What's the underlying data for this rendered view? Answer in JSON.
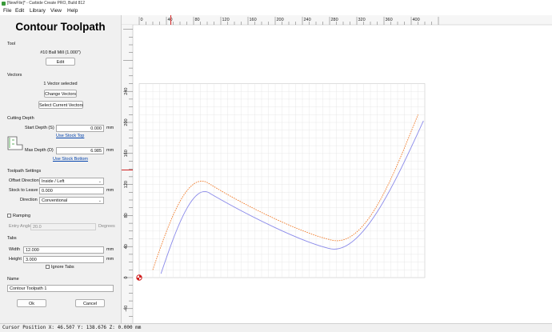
{
  "window": {
    "title": "[NewFile]* - Carbide Create PRO, Build 812"
  },
  "menubar": {
    "items": [
      {
        "label": "File"
      },
      {
        "label": "Edit"
      },
      {
        "label": "Library"
      },
      {
        "label": "View"
      },
      {
        "label": "Help"
      }
    ]
  },
  "panel": {
    "title": "Contour Toolpath",
    "tool": {
      "section_label": "Tool",
      "tool_name": "#10 Ball Mill (1.000\")",
      "edit_label": "Edit"
    },
    "vectors": {
      "section_label": "Vectors",
      "status": "1 Vector selected",
      "change_label": "Change Vectors",
      "select_current_label": "Select Current Vectors"
    },
    "cutting_depth": {
      "section_label": "Cutting Depth",
      "start_depth_label": "Start Depth (S)",
      "start_depth_value": "0.000",
      "start_depth_unit": "mm",
      "use_stock_top_label": "Use Stock Top",
      "max_depth_label": "Max Depth (D)",
      "max_depth_value": "6.985",
      "max_depth_unit": "mm",
      "use_stock_bottom_label": "Use Stock Bottom"
    },
    "toolpath_settings": {
      "section_label": "Toolpath Settings",
      "offset_direction_label": "Offset Direction",
      "offset_direction_value": "Inside / Left",
      "stock_to_leave_label": "Stock to Leave",
      "stock_to_leave_value": "0.000",
      "stock_to_leave_unit": "mm",
      "direction_label": "Direction",
      "direction_value": "Conventional"
    },
    "ramping": {
      "checkbox_label": "Ramping",
      "entry_angle_label": "Entry Angle",
      "entry_angle_value": "20.0",
      "entry_angle_unit": "Degrees"
    },
    "tabs": {
      "section_label": "Tabs",
      "width_label": "Width",
      "width_value": "12.000",
      "width_unit": "mm",
      "height_label": "Height",
      "height_value": "3.000",
      "height_unit": "mm",
      "ignore_label": "Ignore Tabs"
    },
    "name": {
      "section_label": "Name",
      "value": "Contour Toolpath 1"
    },
    "ok_label": "Ok",
    "cancel_label": "Cancel"
  },
  "view": {
    "x_ticks": [
      "0",
      "40",
      "80",
      "120",
      "160",
      "200",
      "240",
      "280",
      "320",
      "360",
      "400"
    ],
    "y_ticks": [
      "240",
      "200",
      "160",
      "120",
      "80",
      "40",
      "0",
      "-40"
    ],
    "toolpath_color": "#f07a28",
    "vector_color": "#8a8aea",
    "marker_color": "#d11f1f",
    "grid_color": "#e2e2e2"
  },
  "statusbar": {
    "text": "Cursor Position X: 46.507 Y: 138.676 Z: 0.000 mm"
  }
}
